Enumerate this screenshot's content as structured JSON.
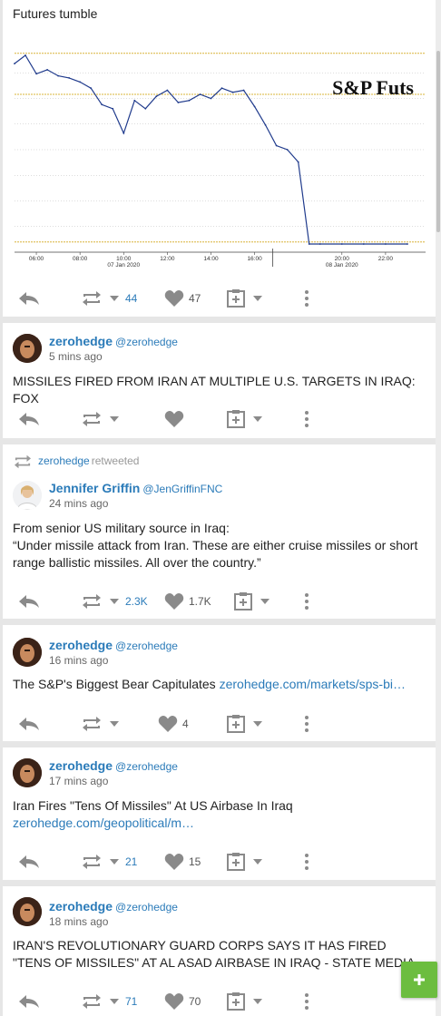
{
  "colors": {
    "link": "#2b7bb9",
    "fab": "#6cbd3f",
    "icon_gray": "#8a8a8a"
  },
  "card0": {
    "text": "Futures tumble",
    "actions": {
      "retweets": "44",
      "likes": "47"
    }
  },
  "chart_data": {
    "type": "line",
    "title": "S&P Futs",
    "x_tick_labels": [
      "06:00",
      "08:00",
      "10:00",
      "12:00",
      "14:00",
      "16:00",
      "20:00",
      "22:00"
    ],
    "date_labels": [
      "07 Jan 2020",
      "08 Jan 2020"
    ],
    "ylabel": "",
    "grid": true,
    "series": [
      {
        "x": [
          "05:00",
          "05:30",
          "06:00",
          "06:30",
          "07:00",
          "07:30",
          "08:00",
          "08:30",
          "09:00",
          "09:30",
          "10:00",
          "10:30",
          "11:00",
          "11:30",
          "12:00",
          "12:30",
          "13:00",
          "13:30",
          "14:00",
          "14:30",
          "15:00",
          "15:30",
          "16:00",
          "16:30",
          "17:00",
          "17:30",
          "18:00",
          "18:30",
          "19:00",
          "20:00",
          "21:00",
          "22:00",
          "23:00"
        ],
        "y": [
          0.92,
          0.96,
          0.87,
          0.89,
          0.86,
          0.85,
          0.83,
          0.8,
          0.72,
          0.7,
          0.58,
          0.74,
          0.7,
          0.76,
          0.79,
          0.73,
          0.74,
          0.77,
          0.75,
          0.8,
          0.78,
          0.79,
          0.71,
          0.62,
          0.52,
          0.5,
          0.44,
          0.04,
          0.04,
          0.04,
          0.04,
          0.04,
          0.04
        ]
      }
    ],
    "reference_lines": [
      0.97,
      0.77,
      0.05
    ]
  },
  "tweets": [
    {
      "name": "zerohedge",
      "handle": "@zerohedge",
      "time": "5 mins ago",
      "text": "MISSILES FIRED FROM IRAN AT MULTIPLE U.S. TARGETS IN IRAQ: FOX",
      "retweets": "",
      "likes": ""
    },
    {
      "retweeted_by": "zerohedge",
      "retweeted_label": "retweeted",
      "name": "Jennifer Griffin",
      "handle": "@JenGriffinFNC",
      "time": "24 mins ago",
      "text_line1": "From senior US military source in Iraq:",
      "text_line2": "“Under missile attack from Iran. These are either cruise missiles or short range ballistic missiles. All over the country.”",
      "retweets": "2.3K",
      "likes": "1.7K"
    },
    {
      "name": "zerohedge",
      "handle": "@zerohedge",
      "time": "16 mins ago",
      "text": "The S&P's Biggest Bear Capitulates ",
      "link": "zerohedge.com/markets/sps-bi…",
      "retweets": "",
      "likes": "4"
    },
    {
      "name": "zerohedge",
      "handle": "@zerohedge",
      "time": "17 mins ago",
      "text": "Iran Fires \"Tens Of Missiles\" At US Airbase In Iraq",
      "link": "zerohedge.com/geopolitical/m…",
      "retweets": "21",
      "likes": "15"
    },
    {
      "name": "zerohedge",
      "handle": "@zerohedge",
      "time": "18 mins ago",
      "text": "IRAN'S REVOLUTIONARY GUARD CORPS SAYS IT HAS FIRED \"TENS OF MISSILES\" AT AL ASAD AIRBASE IN IRAQ - STATE MEDIA",
      "retweets": "71",
      "likes": "70"
    }
  ],
  "fab": {
    "icon": "plus-icon"
  }
}
